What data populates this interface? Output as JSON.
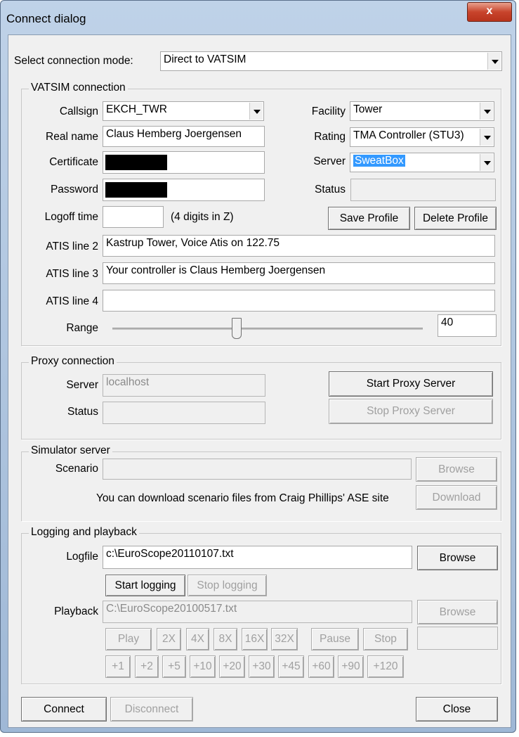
{
  "window": {
    "title": "Connect dialog",
    "close_glyph": "x"
  },
  "mode": {
    "label": "Select connection mode:",
    "value": "Direct to VATSIM"
  },
  "vatsim": {
    "group_title": "VATSIM connection",
    "callsign_label": "Callsign",
    "callsign": "EKCH_TWR",
    "realname_label": "Real name",
    "realname": "Claus Hemberg Joergensen",
    "certificate_label": "Certificate",
    "password_label": "Password",
    "logoff_label": "Logoff time",
    "logoff_value": "",
    "logoff_hint": "(4 digits in Z)",
    "facility_label": "Facility",
    "facility": "Tower",
    "rating_label": "Rating",
    "rating": "TMA Controller (STU3)",
    "server_label": "Server",
    "server": "SweatBox",
    "status_label": "Status",
    "status": "",
    "save_profile": "Save Profile",
    "delete_profile": "Delete Profile",
    "atis2_label": "ATIS line 2",
    "atis2": "Kastrup Tower, Voice Atis on 122.75",
    "atis3_label": "ATIS line 3",
    "atis3": "Your controller is Claus Hemberg Joergensen",
    "atis4_label": "ATIS line 4",
    "atis4": "",
    "range_label": "Range",
    "range_value": "40",
    "range_fraction": 0.4
  },
  "proxy": {
    "group_title": "Proxy connection",
    "server_label": "Server",
    "server": "localhost",
    "status_label": "Status",
    "status": "",
    "start": "Start Proxy Server",
    "stop": "Stop Proxy Server"
  },
  "simulator": {
    "group_title": "Simulator server",
    "scenario_label": "Scenario",
    "scenario": "",
    "browse": "Browse",
    "download_text": "You can download scenario files from Craig Phillips' ASE site",
    "download": "Download"
  },
  "logging": {
    "group_title": "Logging and playback",
    "logfile_label": "Logfile",
    "logfile": "c:\\EuroScope20110107.txt",
    "browse": "Browse",
    "start_logging": "Start logging",
    "stop_logging": "Stop logging",
    "playback_label": "Playback",
    "playback": "C:\\EuroScope20100517.txt",
    "playback_browse": "Browse",
    "play": "Play",
    "x2": "2X",
    "x4": "4X",
    "x8": "8X",
    "x16": "16X",
    "x32": "32X",
    "pause": "Pause",
    "stop": "Stop",
    "time_display": "",
    "p1": "+1",
    "p2": "+2",
    "p5": "+5",
    "p10": "+10",
    "p20": "+20",
    "p30": "+30",
    "p45": "+45",
    "p60": "+60",
    "p90": "+90",
    "p120": "+120"
  },
  "footer": {
    "connect": "Connect",
    "disconnect": "Disconnect",
    "close": "Close"
  },
  "colors": {
    "selection": "#3399ff",
    "face": "#f0f0f0",
    "close_button": "#c8442c"
  }
}
